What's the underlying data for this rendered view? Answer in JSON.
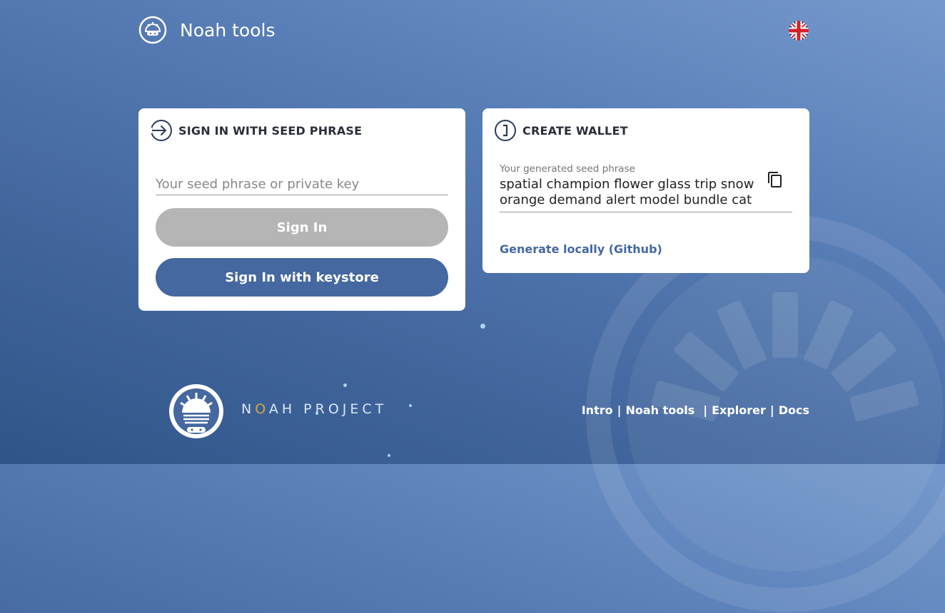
{
  "header": {
    "title": "Noah tools",
    "logo_icon": "noah-ark-icon",
    "language_icon": "uk-flag-icon"
  },
  "signin": {
    "title": "SIGN IN WITH SEED PHRASE",
    "icon": "sign-in-arrow-icon",
    "input_placeholder": "Your seed phrase or private key",
    "input_value": "",
    "signin_label": "Sign In",
    "keystore_label": "Sign In with keystore"
  },
  "create": {
    "title": "CREATE WALLET",
    "icon": "info-circle-icon",
    "seed_label": "Your generated seed phrase",
    "seed_phrase": "spatial champion flower glass trip snow orange demand alert model bundle cat",
    "copy_icon": "copy-icon",
    "generate_link": "Generate locally (Github)"
  },
  "footer": {
    "brand_prefix": "N",
    "brand_accent": "O",
    "brand_suffix": "AH PROJECT",
    "nav": [
      "Intro",
      "Noah tools",
      "Explorer",
      "Docs"
    ]
  },
  "colors": {
    "primary": "#44689f",
    "disabled": "#b5b5b5",
    "background_top": "#7599cc",
    "background_bottom": "#2f5588",
    "accent_gold": "#d8a540"
  }
}
